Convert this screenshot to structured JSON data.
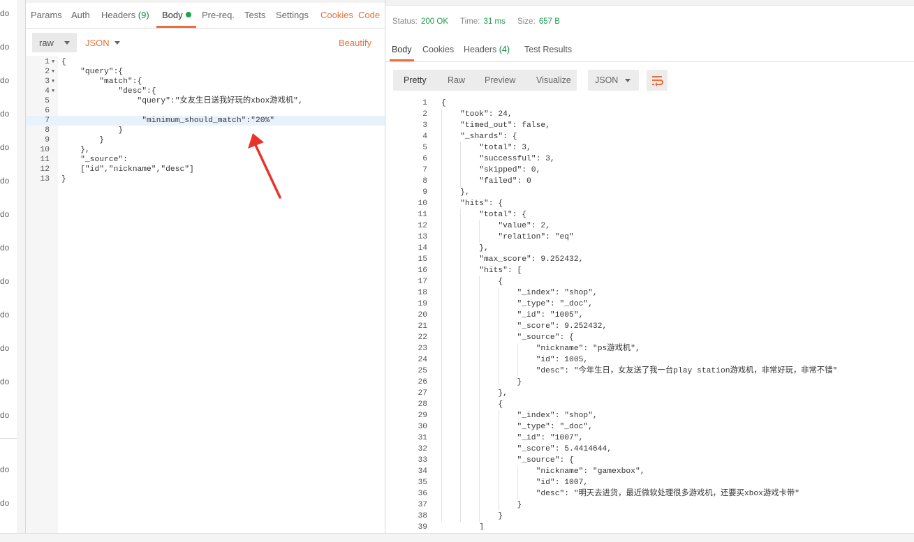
{
  "sidebar": {
    "labels": [
      "do",
      "do",
      "do",
      "do",
      "do",
      "do",
      "do",
      "do",
      "do",
      "do",
      "do",
      "do",
      "do",
      "do",
      "do"
    ]
  },
  "request": {
    "tabs": [
      {
        "label": "Params"
      },
      {
        "label": "Auth"
      },
      {
        "label": "Headers",
        "count": "(9)"
      },
      {
        "label": "Body"
      },
      {
        "label": "Pre-req."
      },
      {
        "label": "Tests"
      },
      {
        "label": "Settings"
      },
      {
        "label": "Cookies"
      },
      {
        "label": "Code"
      }
    ],
    "body_mode": "raw",
    "body_format": "JSON",
    "beautify_label": "Beautify",
    "editor_lines": [
      {
        "n": "1",
        "fold": "▼",
        "text": "{"
      },
      {
        "n": "2",
        "fold": "▼",
        "text": "    \"query\":{"
      },
      {
        "n": "3",
        "fold": "▼",
        "text": "        \"match\":{"
      },
      {
        "n": "4",
        "fold": "▼",
        "text": "            \"desc\":{"
      },
      {
        "n": "5",
        "fold": "",
        "text": "                \"query\":\"女友生日送我好玩的xbox游戏机\","
      },
      {
        "n": "6",
        "fold": "",
        "text": ""
      },
      {
        "n": "7",
        "fold": "",
        "text": "                 \"minimum_should_match\":\"20%\""
      },
      {
        "n": "8",
        "fold": "",
        "text": "            }"
      },
      {
        "n": "9",
        "fold": "",
        "text": "        }"
      },
      {
        "n": "10",
        "fold": "",
        "text": "    },"
      },
      {
        "n": "11",
        "fold": "",
        "text": "    \"_source\":"
      },
      {
        "n": "12",
        "fold": "",
        "text": "    [\"id\",\"nickname\",\"desc\"]"
      },
      {
        "n": "13",
        "fold": "",
        "text": "}"
      }
    ]
  },
  "response": {
    "status_label": "Status:",
    "status_value": "200 OK",
    "time_label": "Time:",
    "time_value": "31 ms",
    "size_label": "Size:",
    "size_value": "657 B",
    "tabs": [
      {
        "label": "Body"
      },
      {
        "label": "Cookies"
      },
      {
        "label": "Headers",
        "count": "(4)"
      },
      {
        "label": "Test Results"
      }
    ],
    "view_buttons": [
      "Pretty",
      "Raw",
      "Preview",
      "Visualize"
    ],
    "format": "JSON",
    "lines": [
      {
        "n": "1",
        "text": "{"
      },
      {
        "n": "2",
        "text": "    \"took\": 24,"
      },
      {
        "n": "3",
        "text": "    \"timed_out\": false,"
      },
      {
        "n": "4",
        "text": "    \"_shards\": {"
      },
      {
        "n": "5",
        "text": "        \"total\": 3,"
      },
      {
        "n": "6",
        "text": "        \"successful\": 3,"
      },
      {
        "n": "7",
        "text": "        \"skipped\": 0,"
      },
      {
        "n": "8",
        "text": "        \"failed\": 0"
      },
      {
        "n": "9",
        "text": "    },"
      },
      {
        "n": "10",
        "text": "    \"hits\": {"
      },
      {
        "n": "11",
        "text": "        \"total\": {"
      },
      {
        "n": "12",
        "text": "            \"value\": 2,"
      },
      {
        "n": "13",
        "text": "            \"relation\": \"eq\""
      },
      {
        "n": "14",
        "text": "        },"
      },
      {
        "n": "15",
        "text": "        \"max_score\": 9.252432,"
      },
      {
        "n": "16",
        "text": "        \"hits\": ["
      },
      {
        "n": "17",
        "text": "            {"
      },
      {
        "n": "18",
        "text": "                \"_index\": \"shop\","
      },
      {
        "n": "19",
        "text": "                \"_type\": \"_doc\","
      },
      {
        "n": "20",
        "text": "                \"_id\": \"1005\","
      },
      {
        "n": "21",
        "text": "                \"_score\": 9.252432,"
      },
      {
        "n": "22",
        "text": "                \"_source\": {"
      },
      {
        "n": "23",
        "text": "                    \"nickname\": \"ps游戏机\","
      },
      {
        "n": "24",
        "text": "                    \"id\": 1005,"
      },
      {
        "n": "25",
        "text": "                    \"desc\": \"今年生日，女友送了我一台play station游戏机，非常好玩，非常不错\""
      },
      {
        "n": "26",
        "text": "                }"
      },
      {
        "n": "27",
        "text": "            },"
      },
      {
        "n": "28",
        "text": "            {"
      },
      {
        "n": "29",
        "text": "                \"_index\": \"shop\","
      },
      {
        "n": "30",
        "text": "                \"_type\": \"_doc\","
      },
      {
        "n": "31",
        "text": "                \"_id\": \"1007\","
      },
      {
        "n": "32",
        "text": "                \"_score\": 5.4414644,"
      },
      {
        "n": "33",
        "text": "                \"_source\": {"
      },
      {
        "n": "34",
        "text": "                    \"nickname\": \"gamexbox\","
      },
      {
        "n": "35",
        "text": "                    \"id\": 1007,"
      },
      {
        "n": "36",
        "text": "                    \"desc\": \"明天去进货，最近微软处理很多游戏机，还要买xbox游戏卡带\""
      },
      {
        "n": "37",
        "text": "                }"
      },
      {
        "n": "38",
        "text": "            }"
      },
      {
        "n": "39",
        "text": "        ]"
      }
    ]
  },
  "colors": {
    "accent": "#f26b3a",
    "success": "#1e9b4a",
    "arrow": "#e8332a"
  }
}
